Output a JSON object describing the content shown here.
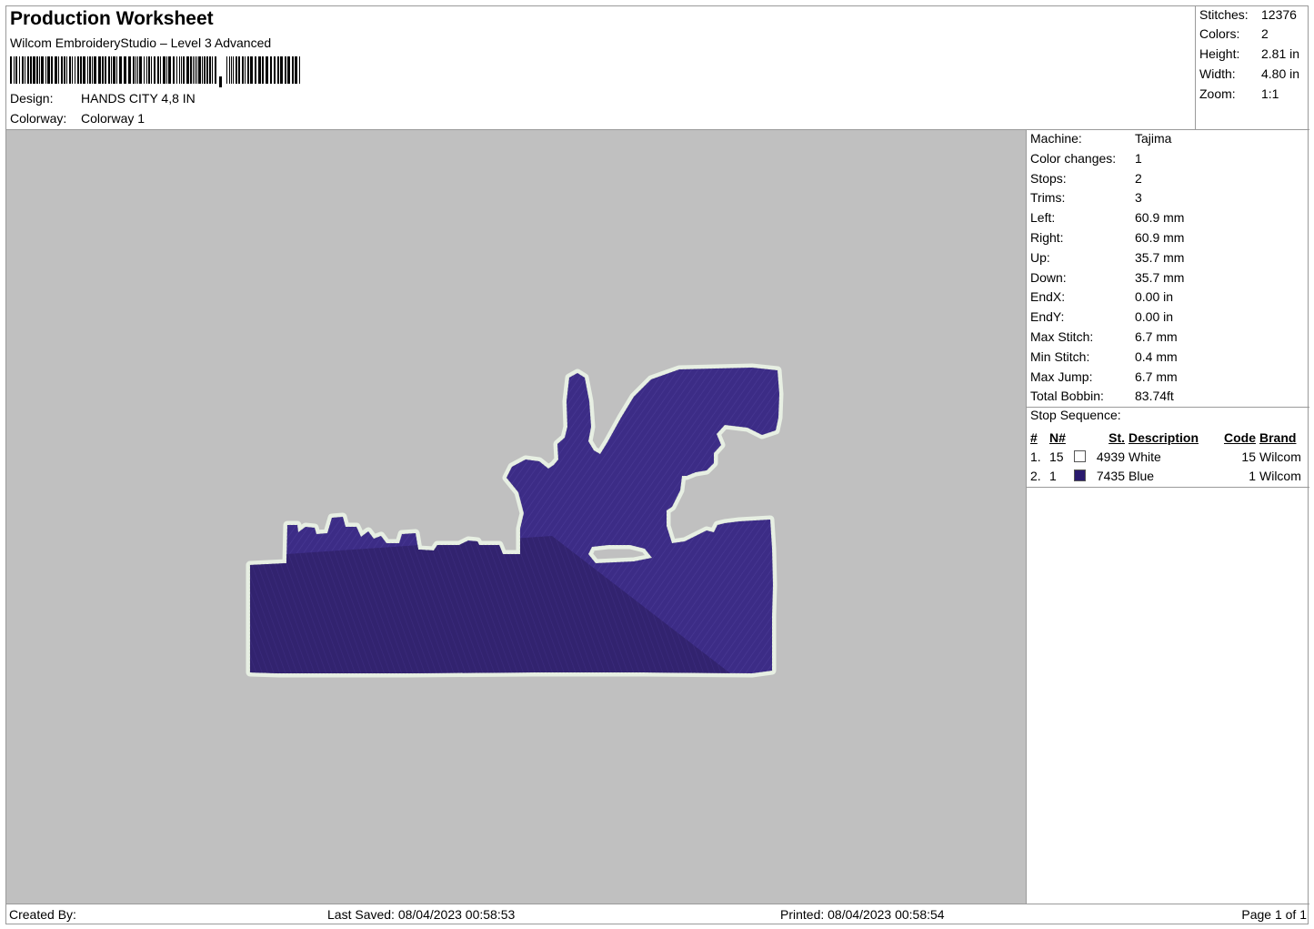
{
  "header": {
    "title": "Production Worksheet",
    "software": "Wilcom EmbroideryStudio – Level 3 Advanced",
    "design_label": "Design:",
    "design_value": "HANDS CITY 4,8 IN",
    "colorway_label": "Colorway:",
    "colorway_value": "Colorway 1"
  },
  "summary": {
    "stitches_label": "Stitches:",
    "stitches": "12376",
    "colors_label": "Colors:",
    "colors": "2",
    "height_label": "Height:",
    "height": "2.81 in",
    "width_label": "Width:",
    "width": "4.80 in",
    "zoom_label": "Zoom:",
    "zoom": "1:1"
  },
  "machine_info": [
    {
      "label": "Machine:",
      "value": "Tajima"
    },
    {
      "label": "Color changes:",
      "value": "1"
    },
    {
      "label": "Stops:",
      "value": "2"
    },
    {
      "label": "Trims:",
      "value": "3"
    },
    {
      "label": "Left:",
      "value": "60.9 mm"
    },
    {
      "label": "Right:",
      "value": "60.9 mm"
    },
    {
      "label": "Up:",
      "value": "35.7 mm"
    },
    {
      "label": "Down:",
      "value": "35.7 mm"
    },
    {
      "label": "EndX:",
      "value": "0.00 in"
    },
    {
      "label": "EndY:",
      "value": "0.00 in"
    },
    {
      "label": "Max Stitch:",
      "value": "6.7 mm"
    },
    {
      "label": "Min Stitch:",
      "value": "0.4 mm"
    },
    {
      "label": "Max Jump:",
      "value": "6.7 mm"
    },
    {
      "label": "Total Bobbin:",
      "value": "83.74ft"
    }
  ],
  "stop_sequence": {
    "title": "Stop Sequence:",
    "headers": {
      "num": "#",
      "n": "N#",
      "st": "St.",
      "description": "Description",
      "code": "Code",
      "brand": "Brand"
    },
    "rows": [
      {
        "num": "1.",
        "n": "15",
        "swatch": "#ffffff",
        "st": "4939",
        "description": "White",
        "code": "15",
        "brand": "Wilcom"
      },
      {
        "num": "2.",
        "n": "1",
        "swatch": "#2a1a6e",
        "st": "7435",
        "description": "Blue",
        "code": "1",
        "brand": "Wilcom"
      }
    ]
  },
  "footer": {
    "created_by": "Created By:",
    "last_saved": "Last Saved: 08/04/2023 00:58:53",
    "printed": "Printed: 08/04/2023 00:58:54",
    "page": "Page 1 of 1"
  },
  "colors": {
    "canvas_bg": "#c0c0c0",
    "thread_blue": "#3c2c86",
    "thread_blue_dark": "#32236f",
    "thread_white": "#e7efe3"
  }
}
